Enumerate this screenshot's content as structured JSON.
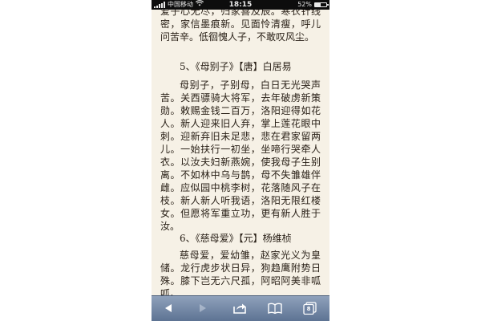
{
  "status_bar": {
    "carrier": "中国移动",
    "time": "18:15",
    "battery_percent_label": "52%",
    "battery_level": 0.52,
    "wifi_icon": "wifi-icon"
  },
  "article": {
    "para_top_1": "爱子心无尽，归家喜及辰。寒衣针线密，家信墨痕新。见面怜清瘦，呼儿问苦辛。低徊愧人子，不敢叹风尘。",
    "heading_5": "5、《母别子》【唐】白居易",
    "para_5": "母别子，子别母，白日无光哭声苦。关西骠骑大将军，去年破虏新策勋。敕赐金钱二百万，洛阳迎得如花人。新人迎来旧人弃，掌上莲花眼中刺。迎新弃旧未足悲，悲在君家留两儿。一始扶行一初坐，坐啼行哭牵人衣。以汝夫妇新燕婉，使我母子生别离。不如林中乌与鹊，母不失雏雄伴雌。应似园中桃李树，花落随风子在枝。新人新人听我语，洛阳无限红楼女。但愿将军重立功，更有新人胜于汝。",
    "heading_6": "6、《慈母爱》【元】杨维桢",
    "para_6": "慈母爱，爱幼雏，赵家光义为皇储。龙行虎步状日异，狗趋鹰附势日殊。膝下岂无六尺孤，阿昭阿美非呱呱。"
  },
  "toolbar": {
    "back_icon": "back-arrow-icon",
    "forward_icon": "forward-arrow-icon",
    "share_icon": "share-icon",
    "bookmarks_icon": "book-icon",
    "tabs_icon": "tabs-icon",
    "tab_count": "8"
  },
  "colors": {
    "page_background": "#f6f1e6",
    "text": "#2a2118",
    "status_bar": "#0d0d0d",
    "toolbar_top": "#8fa1bb",
    "toolbar_bottom": "#5d7393"
  }
}
